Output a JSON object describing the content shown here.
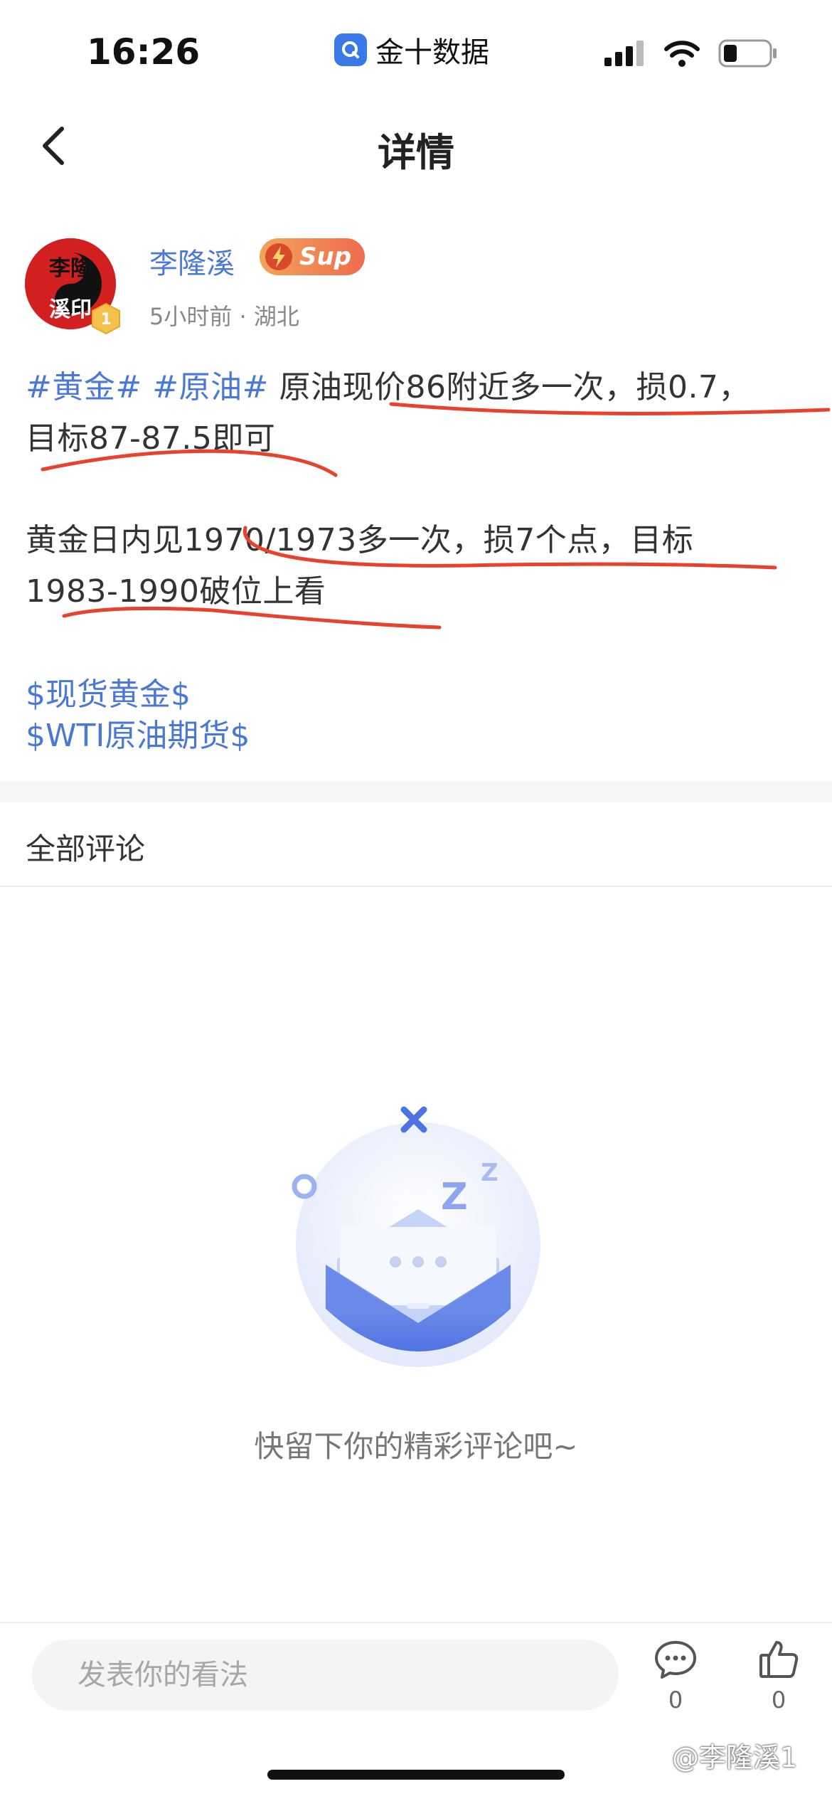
{
  "status_bar": {
    "time": "16:26",
    "app_label": "金十数据"
  },
  "nav": {
    "title": "详情"
  },
  "author": {
    "name": "李隆溪",
    "avatar_text_top": "李隆",
    "avatar_text_bottom": "溪印",
    "level": "1",
    "badge_text": "Sup",
    "meta": "5小时前 · 湖北"
  },
  "post": {
    "line1_tag_gold": "#黄金#",
    "line1_tag_oil": "#原油#",
    "line1_text": "原油现价86附近多一次，损0.7，",
    "line2_text": "目标87-87.5即可",
    "line3_text": "黄金日内见1970/1973多一次，损7个点，目标",
    "line4_text": "1983-1990破位上看",
    "stock_tags": [
      "$现货黄金$",
      "$WTI原油期货$"
    ]
  },
  "comments": {
    "heading": "全部评论",
    "empty_text": "快留下你的精彩评论吧~"
  },
  "bottom_bar": {
    "input_placeholder": "发表你的看法",
    "comment_count": "0",
    "like_count": "0"
  },
  "watermark": "@李隆溪1",
  "colors": {
    "accent_blue": "#4a78d6",
    "annotation_red": "#e8412c"
  }
}
